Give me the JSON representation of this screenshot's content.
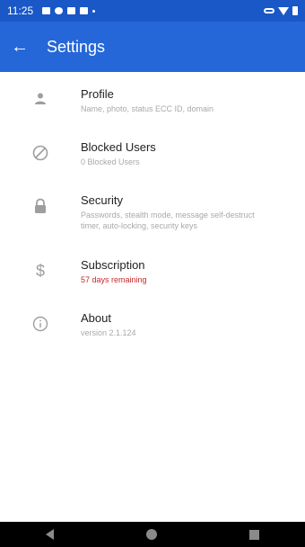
{
  "status_bar": {
    "time": "11:25"
  },
  "app_bar": {
    "title": "Settings",
    "back_icon": "arrow-left-icon"
  },
  "items": [
    {
      "title": "Profile",
      "subtitle": "Name, photo, status ECC ID, domain",
      "icon": "person-icon"
    },
    {
      "title": "Blocked Users",
      "subtitle": "0 Blocked Users",
      "icon": "block-icon"
    },
    {
      "title": "Security",
      "subtitle": "Passwords, stealth mode, message self-destruct timer, auto-locking, security keys",
      "icon": "lock-icon"
    },
    {
      "title": "Subscription",
      "subtitle": "57 days remaining",
      "icon": "dollar-icon",
      "subtitle_color": "#c62828"
    },
    {
      "title": "About",
      "subtitle": "version 2.1.124",
      "icon": "info-icon"
    }
  ],
  "colors": {
    "app_bar": "#2567d8",
    "status_bar": "#1a57c7",
    "alert": "#c62828"
  }
}
